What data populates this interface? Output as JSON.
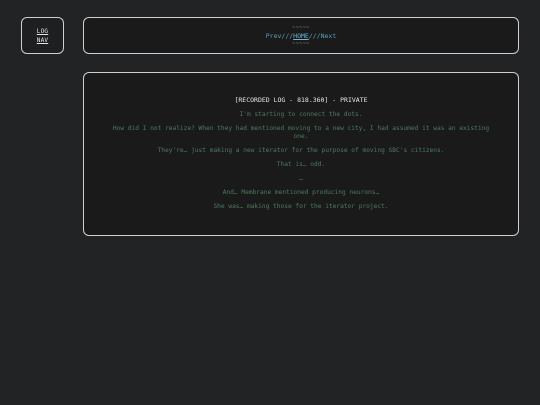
{
  "lognav": {
    "line1": "LOG",
    "line2": "NAV"
  },
  "nav": {
    "dashes_top": "~~~~~",
    "prev_label": "Prev",
    "sep1": "///",
    "home_label": "HOME",
    "sep2": "///",
    "next_label": "Next",
    "dashes_bottom": "~~~~~"
  },
  "log": {
    "title": "[RECORDED LOG - 818.360] - PRIVATE",
    "lines": [
      "I'm starting to connect the dots.",
      "How did I not realize? When they had mentioned moving to a new city, I had assumed it was an existing one.",
      "They're… just making a new iterator for the purpose of moving SBC's citizens.",
      "That is… odd.",
      "…",
      "And… Membrane mentioned producing neurons…",
      "She was… making those for the iterator project."
    ]
  },
  "colors": {
    "background": "#222325",
    "border": "#cfcfcf",
    "log_text": "#4e7a5e",
    "nav_link": "#5ea0b8"
  }
}
